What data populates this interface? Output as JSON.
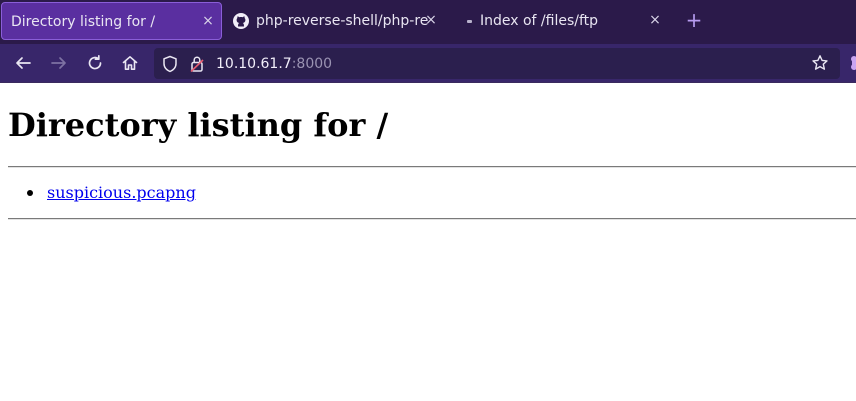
{
  "tabs": [
    {
      "title": "Directory listing for /",
      "active": true
    },
    {
      "title": "php-reverse-shell/php-re",
      "icon": "github-icon"
    },
    {
      "title": "Index of /files/ftp",
      "icon": "page-dot-icon"
    }
  ],
  "tab_close_symbol": "×",
  "new_tab_symbol": "+",
  "nav": {
    "url_host": "10.10.61.7",
    "url_port": ":8000",
    "icons": [
      "back-arrow-icon",
      "forward-arrow-icon",
      "reload-icon",
      "home-icon",
      "shield-icon",
      "lock-icon",
      "bookmark-star-icon",
      "extension-icon"
    ]
  },
  "page": {
    "heading": "Directory listing for /",
    "files": [
      "suspicious.pcapng"
    ]
  },
  "colors": {
    "tabbar": "#2b1a4a",
    "active_tab": "#5a2fa0",
    "navbar": "#38266a",
    "urlbar": "#2b1f4e",
    "link": "#0000ee"
  }
}
